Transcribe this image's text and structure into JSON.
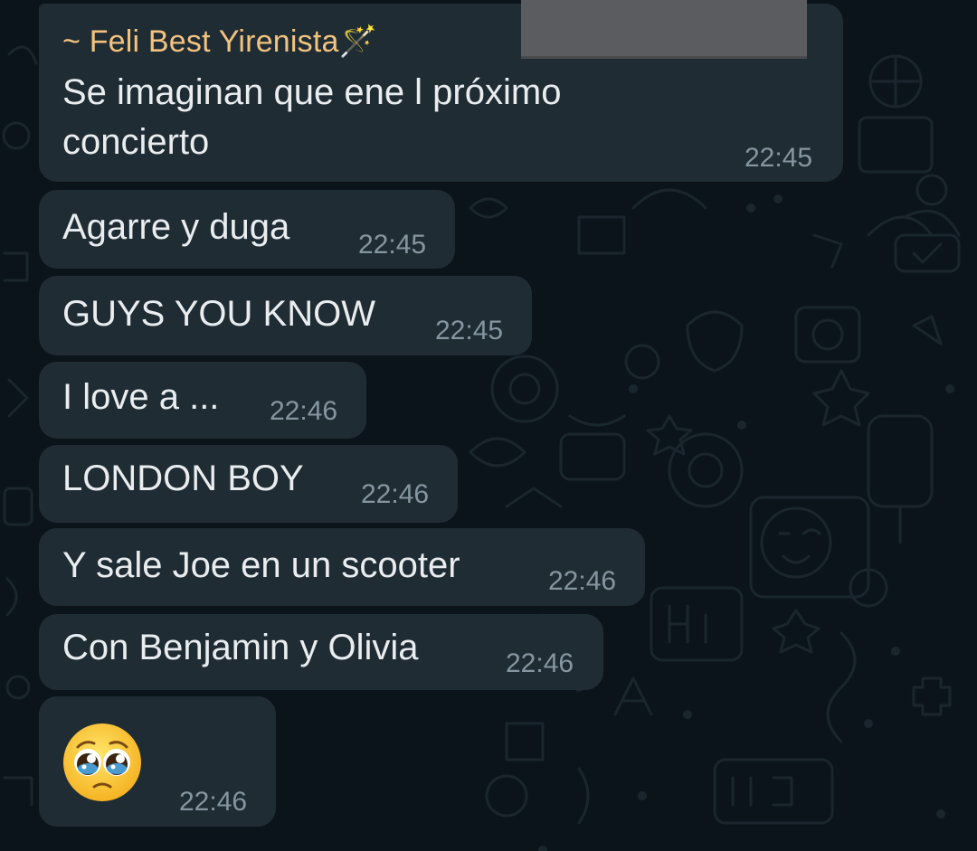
{
  "chat": {
    "first_message": {
      "sender": "~ Feli Best Yirenista🪄",
      "text_line1": "Se imaginan que ene l próximo",
      "text_line2": "concierto",
      "time": "22:45"
    },
    "messages": [
      {
        "text": "Agarre y duga",
        "time": "22:45"
      },
      {
        "text": "GUYS YOU KNOW",
        "time": "22:45"
      },
      {
        "text": "I love a ...",
        "time": "22:46"
      },
      {
        "text": "LONDON BOY",
        "time": "22:46"
      },
      {
        "text": "Y sale Joe en un scooter",
        "time": "22:46"
      },
      {
        "text": "Con Benjamin y Olivia",
        "time": "22:46"
      }
    ],
    "emoji_message": {
      "emoji": "pleading-face",
      "time": "22:46"
    }
  },
  "colors": {
    "background": "#0b141a",
    "bubble": "#1f2c34",
    "message_text": "#e9edef",
    "timestamp": "#8696a0",
    "sender_name": "#f2c37f",
    "redaction": "#5b5c60"
  }
}
